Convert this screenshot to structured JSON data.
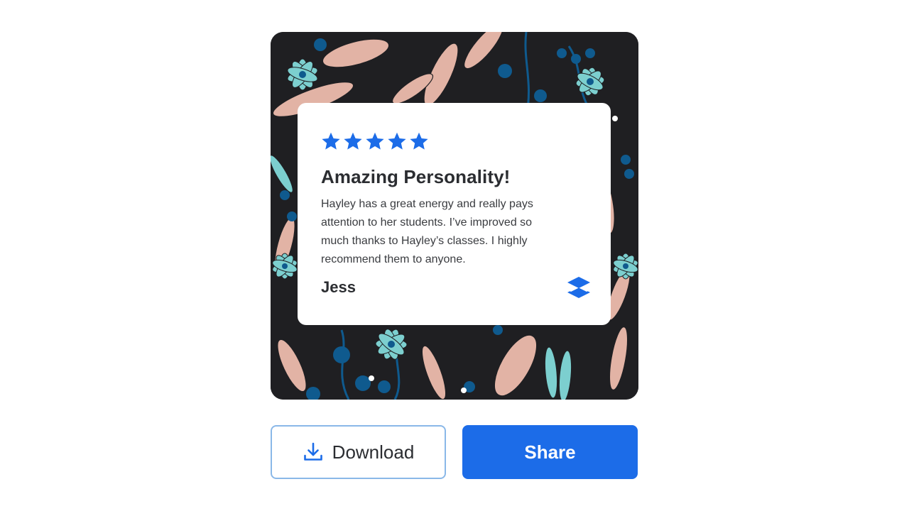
{
  "review": {
    "rating_stars": 5,
    "title": "Amazing Personality!",
    "body": "Hayley has a great energy and really pays attention to her students. I’ve improved so much thanks to Hayley’s classes. I highly recommend them to anyone.",
    "author": "Jess",
    "brand_icon": "layers-icon"
  },
  "actions": {
    "download_label": "Download",
    "download_icon": "download-icon",
    "share_label": "Share"
  },
  "colors": {
    "accent": "#1c6ce8",
    "card_background_dark": "#1f1f22",
    "pattern_pink": "#e2b3a5",
    "pattern_teal": "#7ccfcf",
    "pattern_navy": "#0f5a8e",
    "download_border": "#8ab8e8"
  }
}
